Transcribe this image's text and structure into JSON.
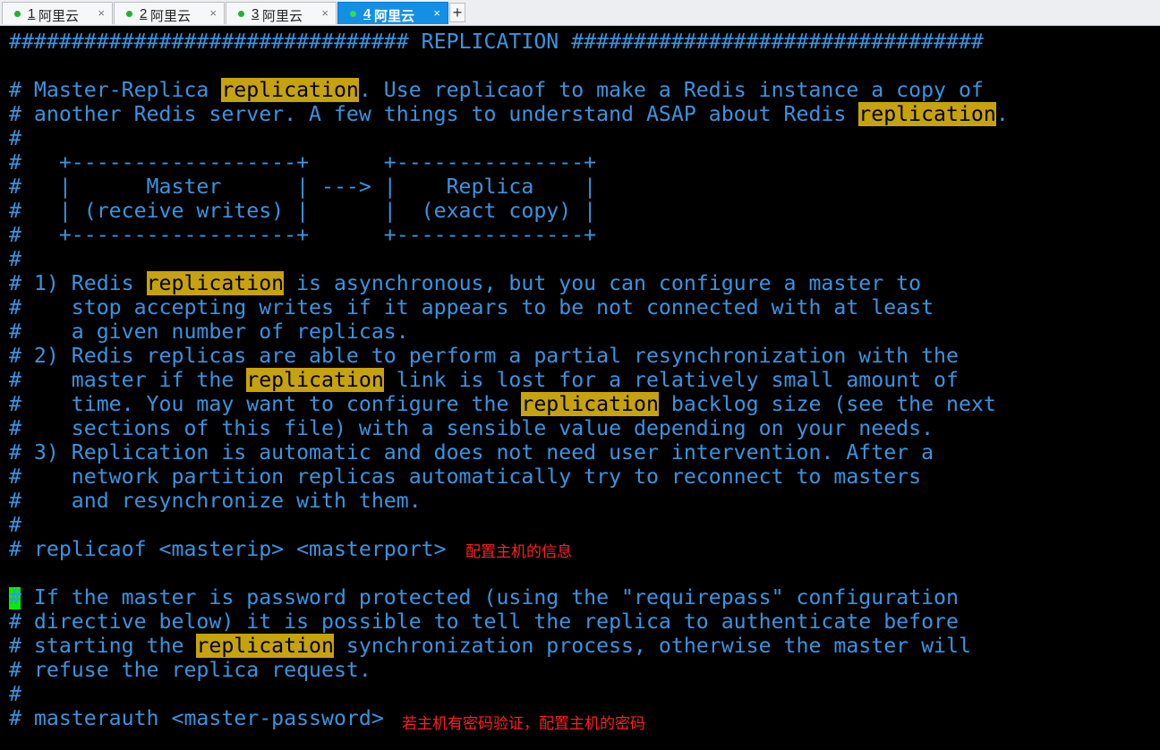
{
  "tabs": [
    {
      "num": "1",
      "name": "阿里云",
      "close": "×"
    },
    {
      "num": "2",
      "name": "阿里云",
      "close": "×"
    },
    {
      "num": "3",
      "name": "阿里云",
      "close": "×"
    },
    {
      "num": "4",
      "name": "阿里云",
      "close": "×"
    }
  ],
  "add_tab": "+",
  "terminal": {
    "lines": [
      [
        {
          "t": "################################ REPLICATION #################################"
        }
      ],
      [
        {
          "t": ""
        }
      ],
      [
        {
          "t": "# Master-Replica "
        },
        {
          "t": "replication",
          "hl": true
        },
        {
          "t": ". Use replicaof to make a Redis instance a copy of"
        }
      ],
      [
        {
          "t": "# another Redis server. A few things to understand ASAP about Redis "
        },
        {
          "t": "replication",
          "hl": true
        },
        {
          "t": "."
        }
      ],
      [
        {
          "t": "#"
        }
      ],
      [
        {
          "t": "#   +------------------+      +---------------+"
        }
      ],
      [
        {
          "t": "#   |      Master      | ---> |    Replica    |"
        }
      ],
      [
        {
          "t": "#   | (receive writes) |      |  (exact copy) |"
        }
      ],
      [
        {
          "t": "#   +------------------+      +---------------+"
        }
      ],
      [
        {
          "t": "#"
        }
      ],
      [
        {
          "t": "# 1) Redis "
        },
        {
          "t": "replication",
          "hl": true
        },
        {
          "t": " is asynchronous, but you can configure a master to"
        }
      ],
      [
        {
          "t": "#    stop accepting writes if it appears to be not connected with at least"
        }
      ],
      [
        {
          "t": "#    a given number of replicas."
        }
      ],
      [
        {
          "t": "# 2) Redis replicas are able to perform a partial resynchronization with the"
        }
      ],
      [
        {
          "t": "#    master if the "
        },
        {
          "t": "replication",
          "hl": true
        },
        {
          "t": " link is lost for a relatively small amount of"
        }
      ],
      [
        {
          "t": "#    time. You may want to configure the "
        },
        {
          "t": "replication",
          "hl": true
        },
        {
          "t": " backlog size (see the next"
        }
      ],
      [
        {
          "t": "#    sections of this file) with a sensible value depending on your needs."
        }
      ],
      [
        {
          "t": "# 3) Replication is automatic and does not need user intervention. After a"
        }
      ],
      [
        {
          "t": "#    network partition replicas automatically try to reconnect to masters"
        }
      ],
      [
        {
          "t": "#    and resynchronize with them."
        }
      ],
      [
        {
          "t": "#"
        }
      ],
      [
        {
          "t": "# replicaof <masterip> <masterport>"
        }
      ],
      [
        {
          "t": ""
        }
      ],
      [
        {
          "t": "# If the master is password protected (using the \"requirepass\" configuration"
        }
      ],
      [
        {
          "t": "# directive below) it is possible to tell the replica to authenticate before"
        }
      ],
      [
        {
          "t": "# starting the "
        },
        {
          "t": "replication",
          "hl": true
        },
        {
          "t": " synchronization process, otherwise the master will"
        }
      ],
      [
        {
          "t": "# refuse the replica request."
        }
      ],
      [
        {
          "t": "#"
        }
      ],
      [
        {
          "t": "# masterauth <master-password>"
        }
      ]
    ]
  },
  "annotations": {
    "replicaof_note": "配置主机的信息",
    "masterauth_note": "若主机有密码验证，配置主机的密码"
  },
  "colors": {
    "terminal_bg": "#000000",
    "text": "#3a94e0",
    "highlight": "#c6a20f",
    "cursor": "#00f000",
    "annotation": "#ff2020",
    "active_tab": "#1390e5"
  }
}
